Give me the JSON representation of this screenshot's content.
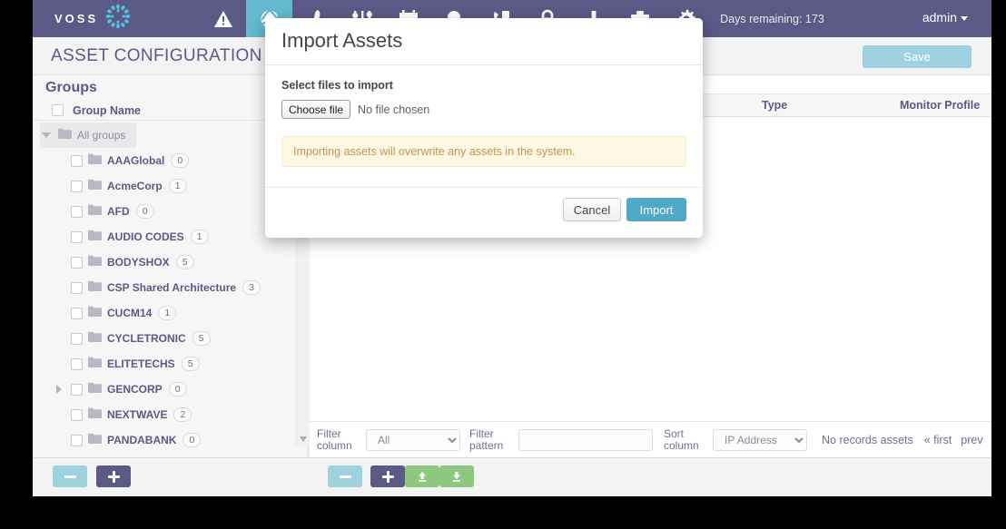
{
  "header": {
    "logo_text": "VOSS",
    "logo_icon": "dotted-ring-logo",
    "days_remaining": "Days remaining: 173",
    "user_menu": "admin",
    "icons": [
      {
        "name": "warning-icon",
        "label": "Alerts"
      },
      {
        "name": "globe-icon",
        "label": "Assets",
        "active": true
      },
      {
        "name": "pen-icon",
        "label": "Edit"
      },
      {
        "name": "sliders-icon",
        "label": "Settings"
      },
      {
        "name": "calendar-icon",
        "label": "Schedule"
      },
      {
        "name": "magnifier-icon",
        "label": "Search"
      },
      {
        "name": "phone-icon",
        "label": "Phones"
      },
      {
        "name": "lock-icon",
        "label": "Security"
      },
      {
        "name": "download-icon",
        "label": "Downloads"
      },
      {
        "name": "briefcase-icon",
        "label": "Reports"
      },
      {
        "name": "gear-icon",
        "label": "Configuration"
      }
    ]
  },
  "titlebar": {
    "page_title": "ASSET CONFIGURATION",
    "save_label": "Save"
  },
  "sidebar": {
    "heading": "Groups",
    "column_header": "Group Name",
    "root": {
      "label": "All groups",
      "expanded": true
    },
    "items": [
      {
        "label": "AAAGlobal",
        "count": "0",
        "expandable": false
      },
      {
        "label": "AcmeCorp",
        "count": "1",
        "expandable": false
      },
      {
        "label": "AFD",
        "count": "0",
        "expandable": false
      },
      {
        "label": "AUDIO CODES",
        "count": "1",
        "expandable": false
      },
      {
        "label": "BODYSHOX",
        "count": "5",
        "expandable": false
      },
      {
        "label": "CSP Shared Architecture",
        "count": "3",
        "expandable": false
      },
      {
        "label": "CUCM14",
        "count": "1",
        "expandable": false
      },
      {
        "label": "CYCLETRONIC",
        "count": "5",
        "expandable": false
      },
      {
        "label": "ELITETECHS",
        "count": "5",
        "expandable": false
      },
      {
        "label": "GENCORP",
        "count": "0",
        "expandable": true
      },
      {
        "label": "NEXTWAVE",
        "count": "2",
        "expandable": false
      },
      {
        "label": "PANDABANK",
        "count": "0",
        "expandable": false
      }
    ]
  },
  "table": {
    "columns": [
      "Type",
      "Monitor Profile"
    ],
    "rows": []
  },
  "filter_bar": {
    "filter_column_label": "Filter column",
    "filter_column_value": "All",
    "filter_pattern_label": "Filter pattern",
    "filter_pattern_value": "",
    "sort_column_label": "Sort column",
    "sort_column_value": "IP Address",
    "records_text": "No records assets",
    "first_link": "« first",
    "prev_link": "prev"
  },
  "bottom_bar": {
    "left_buttons": [
      {
        "name": "remove-group-button",
        "glyph": "minus",
        "color": "#9ed2e0"
      },
      {
        "name": "add-group-button",
        "glyph": "plus",
        "color": "#5b5a87"
      }
    ],
    "right_buttons": [
      {
        "name": "remove-asset-button",
        "glyph": "minus",
        "color": "#9ed2e0"
      },
      {
        "name": "add-asset-button",
        "glyph": "plus",
        "color": "#5b5a87"
      },
      {
        "name": "export-assets-button",
        "glyph": "upload",
        "color": "#8cc97e"
      },
      {
        "name": "import-assets-button",
        "glyph": "download",
        "color": "#8cc97e"
      }
    ]
  },
  "modal": {
    "title": "Import Assets",
    "select_label": "Select files to import",
    "choose_file_label": "Choose file",
    "no_file_text": "No file chosen",
    "warning_text": "Importing assets will overwrite any assets in the system.",
    "cancel_label": "Cancel",
    "import_label": "Import"
  },
  "colors": {
    "header_purple": "#5b5a87",
    "accent_teal": "#63b9cd",
    "button_blue": "#4fa8c7",
    "light_blue": "#9ed2e0",
    "green": "#8cc97e",
    "warning_bg": "#fcf8e3",
    "warning_text": "#c09853"
  }
}
